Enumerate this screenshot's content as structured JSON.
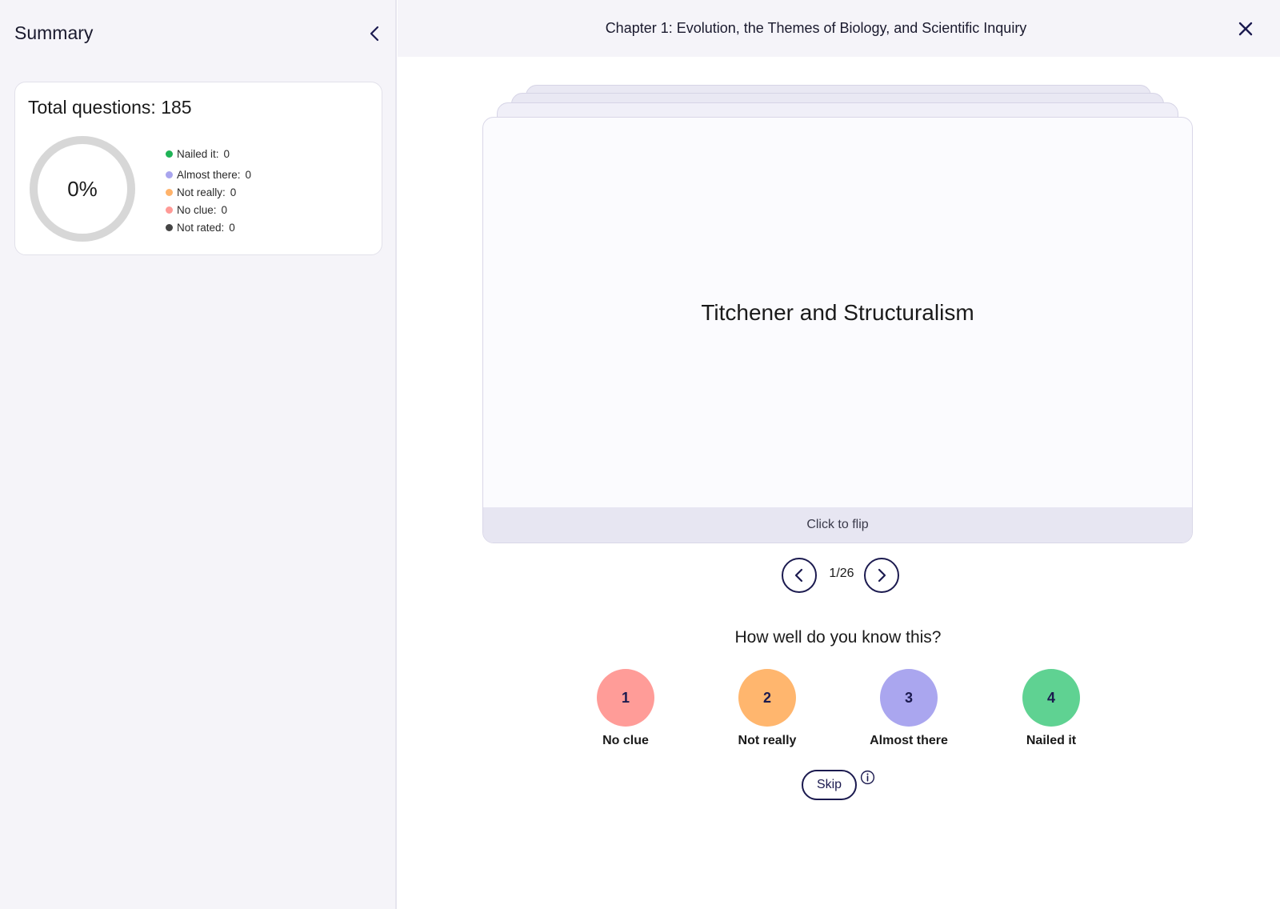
{
  "sidebar": {
    "title": "Summary",
    "total_questions_label": "Total questions: 185",
    "progress_percent": "0%",
    "progress_fraction": 0,
    "legend": [
      {
        "label": "Nailed it:",
        "value": "0",
        "color": "#1fb356"
      },
      {
        "label": "Almost there:",
        "value": "0",
        "color": "#a9a5ee"
      },
      {
        "label": "Not really:",
        "value": "0",
        "color": "#ffb36b"
      },
      {
        "label": "No clue:",
        "value": "0",
        "color": "#ff9a96"
      },
      {
        "label": "Not rated:",
        "value": "0",
        "color": "#444444"
      }
    ]
  },
  "header": {
    "title": "Chapter 1: Evolution, the Themes of Biology, and Scientific Inquiry",
    "close_icon": "close-icon"
  },
  "card": {
    "term": "Titchener and Structuralism",
    "flip_hint": "Click to flip"
  },
  "pager": {
    "position": "1/26",
    "prev_icon": "chevron-left-icon",
    "next_icon": "chevron-right-icon"
  },
  "rating": {
    "question": "How well do you know this?",
    "options": [
      {
        "number": "1",
        "label": "No clue",
        "color": "#ff9c98"
      },
      {
        "number": "2",
        "label": "Not really",
        "color": "#ffb66e"
      },
      {
        "number": "3",
        "label": "Almost there",
        "color": "#aaa6ef"
      },
      {
        "number": "4",
        "label": "Nailed it",
        "color": "#5fd292"
      }
    ],
    "skip_label": "Skip"
  }
}
